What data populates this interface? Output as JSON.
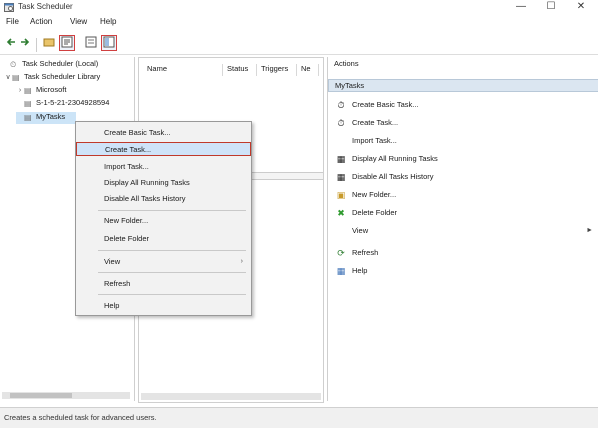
{
  "window": {
    "title": "Task Scheduler",
    "min": "—",
    "max": "☐",
    "close": "✕"
  },
  "menu": [
    "File",
    "Action",
    "View",
    "Help"
  ],
  "toolbar": [
    "back-icon",
    "forward-icon",
    "folder-icon",
    "properties-icon",
    "help-icon",
    "panel-icon"
  ],
  "tree": {
    "items": [
      {
        "label": "Task Scheduler (Local)",
        "twisty": "",
        "indent": 0
      },
      {
        "label": "Task Scheduler Library",
        "twisty": "∨",
        "indent": 1
      },
      {
        "label": "Microsoft",
        "twisty": "›",
        "indent": 2
      },
      {
        "label": "S-1-5-21-2304928594",
        "twisty": "",
        "indent": 2
      },
      {
        "label": "MyTasks",
        "twisty": "",
        "indent": 2
      }
    ]
  },
  "center": {
    "columns": [
      "Name",
      "Status",
      "Triggers",
      "Ne"
    ]
  },
  "actions": {
    "header": "Actions",
    "section": "MyTasks",
    "items": [
      {
        "label": "Create Basic Task...",
        "icon": "create-basic-task-icon",
        "arrow": ""
      },
      {
        "label": "Create Task...",
        "icon": "create-task-icon",
        "arrow": ""
      },
      {
        "label": "Import Task...",
        "icon": "",
        "arrow": ""
      },
      {
        "label": "Display All Running Tasks",
        "icon": "running-tasks-icon",
        "arrow": ""
      },
      {
        "label": "Disable All Tasks History",
        "icon": "history-icon",
        "arrow": ""
      },
      {
        "label": "New Folder...",
        "icon": "new-folder-icon",
        "arrow": ""
      },
      {
        "label": "Delete Folder",
        "icon": "delete-icon",
        "arrow": ""
      },
      {
        "label": "View",
        "icon": "",
        "arrow": "►"
      },
      {
        "label": "Refresh",
        "icon": "refresh-icon",
        "arrow": ""
      },
      {
        "label": "Help",
        "icon": "help-icon",
        "arrow": ""
      }
    ]
  },
  "context_menu": {
    "items": [
      {
        "label": "Create Basic Task...",
        "arrow": "",
        "highlighted": false
      },
      {
        "label": "Create Task...",
        "arrow": "",
        "highlighted": true
      },
      {
        "label": "Import Task...",
        "arrow": "",
        "highlighted": false
      },
      {
        "label": "Display All Running Tasks",
        "arrow": "",
        "highlighted": false
      },
      {
        "label": "Disable All Tasks History",
        "arrow": "",
        "highlighted": false
      },
      {
        "label": "New Folder...",
        "arrow": "",
        "highlighted": false
      },
      {
        "label": "Delete Folder",
        "arrow": "",
        "highlighted": false
      },
      {
        "label": "View",
        "arrow": "›",
        "highlighted": false
      },
      {
        "label": "Refresh",
        "arrow": "",
        "highlighted": false
      },
      {
        "label": "Help",
        "arrow": "",
        "highlighted": false
      }
    ]
  },
  "status": {
    "text": "Creates a scheduled task for advanced users."
  },
  "colors": {
    "selection": "#cce4f7",
    "highlight_border": "#c0392b",
    "delete_icon": "#2e9a2e",
    "help_icon": "#3a6fb5"
  }
}
